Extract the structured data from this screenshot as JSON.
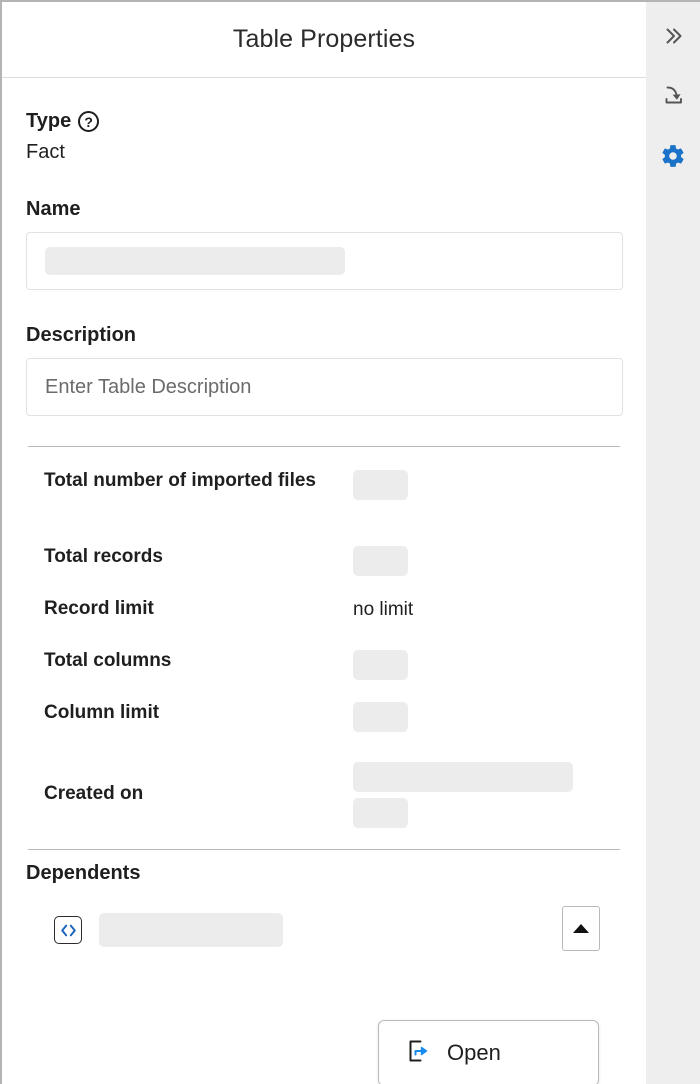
{
  "panel": {
    "title": "Table Properties"
  },
  "type": {
    "label": "Type",
    "help_icon": "question-circle-icon",
    "value": "Fact"
  },
  "name": {
    "label": "Name",
    "value": "",
    "redacted": true
  },
  "description": {
    "label": "Description",
    "value": "",
    "placeholder": "Enter Table Description"
  },
  "stats": [
    {
      "label": "Total number of imported files",
      "value": "",
      "redacted": true,
      "redact_size": "small"
    },
    {
      "label": "Total records",
      "value": "",
      "redacted": true,
      "redact_size": "small"
    },
    {
      "label": "Record limit",
      "value": "no limit",
      "redacted": false
    },
    {
      "label": "Total columns",
      "value": "",
      "redacted": true,
      "redact_size": "small"
    },
    {
      "label": "Column limit",
      "value": "",
      "redacted": true,
      "redact_size": "small"
    },
    {
      "label": "Created on",
      "value": "",
      "redacted": true,
      "redact_size": "large-stacked"
    }
  ],
  "dependents": {
    "title": "Dependents",
    "item": {
      "icon": "worksheet-code-icon",
      "name": "",
      "redacted": true
    },
    "toggle_icon": "caret-up-icon"
  },
  "context_menu": {
    "items": [
      {
        "label": "Open",
        "icon": "open-in-new-icon"
      }
    ]
  },
  "rail": {
    "buttons": [
      {
        "icon": "chevron-double-right-icon",
        "name": "expand-panel"
      },
      {
        "icon": "import-download-icon",
        "name": "import"
      },
      {
        "icon": "gear-icon",
        "name": "settings"
      }
    ]
  },
  "colors": {
    "accent_blue": "#1a73c8",
    "icon_gray": "#555555",
    "redact_gray": "#ececec",
    "border_gray": "#b9b9b9",
    "rail_bg": "#eeeeee"
  }
}
